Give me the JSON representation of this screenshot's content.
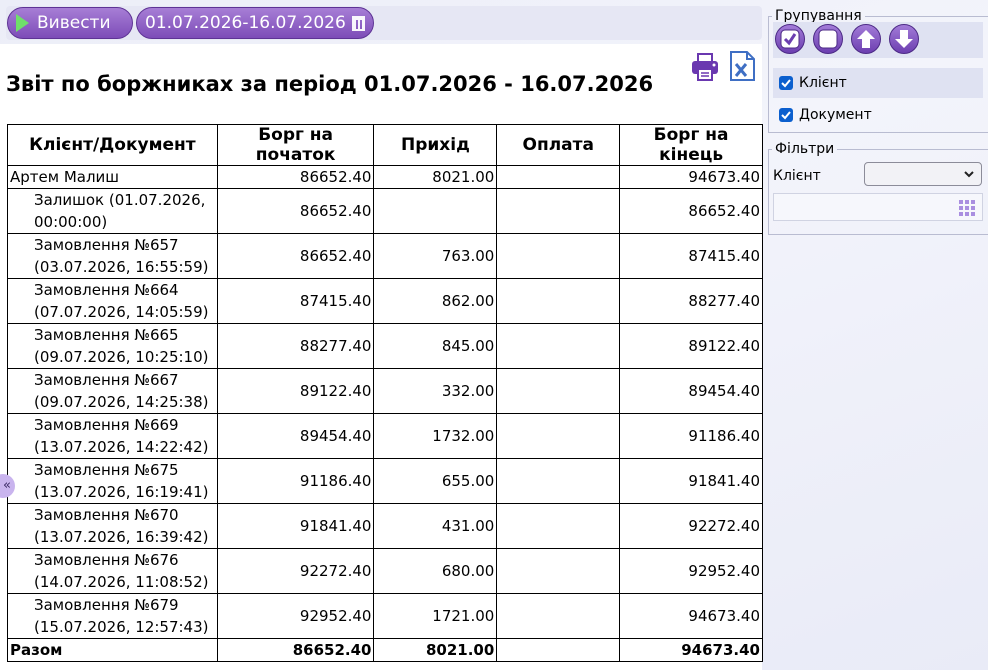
{
  "toolbar": {
    "run_label": "Вивести",
    "date_range": "01.07.2026-16.07.2026"
  },
  "report": {
    "title": "Звіт по боржниках за період 01.07.2026 - 16.07.2026",
    "columns": [
      "Клієнт/Документ",
      "Борг на початок",
      "Прихід",
      "Оплата",
      "Борг на кінець"
    ],
    "group": {
      "name": "Артем Малиш",
      "start": "86652.40",
      "income": "8021.00",
      "payment": "",
      "end": "94673.40"
    },
    "rows": [
      {
        "line1": "Залишок (01.07.2026,",
        "line2": "00:00:00)",
        "start": "86652.40",
        "income": "",
        "payment": "",
        "end": "86652.40"
      },
      {
        "line1": "Замовлення №657",
        "line2": "(03.07.2026, 16:55:59)",
        "start": "86652.40",
        "income": "763.00",
        "payment": "",
        "end": "87415.40"
      },
      {
        "line1": "Замовлення №664",
        "line2": "(07.07.2026, 14:05:59)",
        "start": "87415.40",
        "income": "862.00",
        "payment": "",
        "end": "88277.40"
      },
      {
        "line1": "Замовлення №665",
        "line2": "(09.07.2026, 10:25:10)",
        "start": "88277.40",
        "income": "845.00",
        "payment": "",
        "end": "89122.40"
      },
      {
        "line1": "Замовлення №667",
        "line2": "(09.07.2026, 14:25:38)",
        "start": "89122.40",
        "income": "332.00",
        "payment": "",
        "end": "89454.40"
      },
      {
        "line1": "Замовлення №669",
        "line2": "(13.07.2026, 14:22:42)",
        "start": "89454.40",
        "income": "1732.00",
        "payment": "",
        "end": "91186.40"
      },
      {
        "line1": "Замовлення №675",
        "line2": "(13.07.2026, 16:19:41)",
        "start": "91186.40",
        "income": "655.00",
        "payment": "",
        "end": "91841.40"
      },
      {
        "line1": "Замовлення №670",
        "line2": "(13.07.2026, 16:39:42)",
        "start": "91841.40",
        "income": "431.00",
        "payment": "",
        "end": "92272.40"
      },
      {
        "line1": "Замовлення №676",
        "line2": "(14.07.2026, 11:08:52)",
        "start": "92272.40",
        "income": "680.00",
        "payment": "",
        "end": "92952.40"
      },
      {
        "line1": "Замовлення №679",
        "line2": "(15.07.2026, 12:57:43)",
        "start": "92952.40",
        "income": "1721.00",
        "payment": "",
        "end": "94673.40"
      }
    ],
    "total": {
      "label": "Разом",
      "start": "86652.40",
      "income": "8021.00",
      "payment": "",
      "end": "94673.40"
    },
    "collapse_glyph": "«"
  },
  "grouping": {
    "legend": "Групування",
    "options": [
      {
        "label": "Клієнт",
        "checked": true
      },
      {
        "label": "Документ",
        "checked": true
      }
    ]
  },
  "filters": {
    "legend": "Фільтри",
    "client_label": "Клієнт",
    "client_value": "",
    "search_value": ""
  },
  "colors": {
    "accent": "#7d4cb8",
    "play": "#6fe06a",
    "checkbox": "#0b5fce",
    "excel": "#3f6fc4"
  }
}
